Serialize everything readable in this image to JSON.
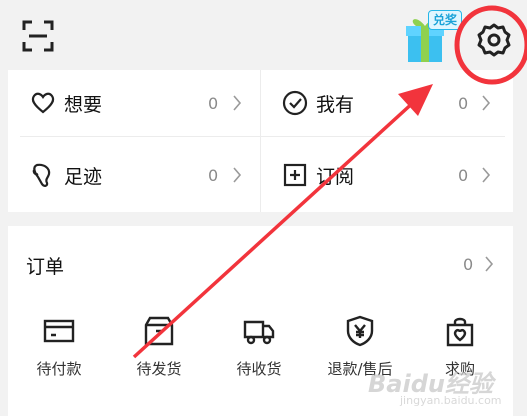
{
  "header": {
    "gift_badge": "兑奖"
  },
  "summary": {
    "wants": {
      "label": "想要",
      "count": "0"
    },
    "owned": {
      "label": "我有",
      "count": "0"
    },
    "footprints": {
      "label": "足迹",
      "count": "0"
    },
    "subscriptions": {
      "label": "订阅",
      "count": "0"
    }
  },
  "orders": {
    "title": "订单",
    "count": "0",
    "items": [
      {
        "label": "待付款",
        "icon": "card-icon"
      },
      {
        "label": "待发货",
        "icon": "box-icon"
      },
      {
        "label": "待收货",
        "icon": "truck-icon"
      },
      {
        "label": "退款/售后",
        "icon": "shield-yen-icon"
      },
      {
        "label": "求购",
        "icon": "bag-heart-icon"
      }
    ]
  },
  "annotation": {
    "color": "#f2343c"
  },
  "watermark": {
    "text": "Baidu经验",
    "sub": "jingyan.baidu.com"
  }
}
